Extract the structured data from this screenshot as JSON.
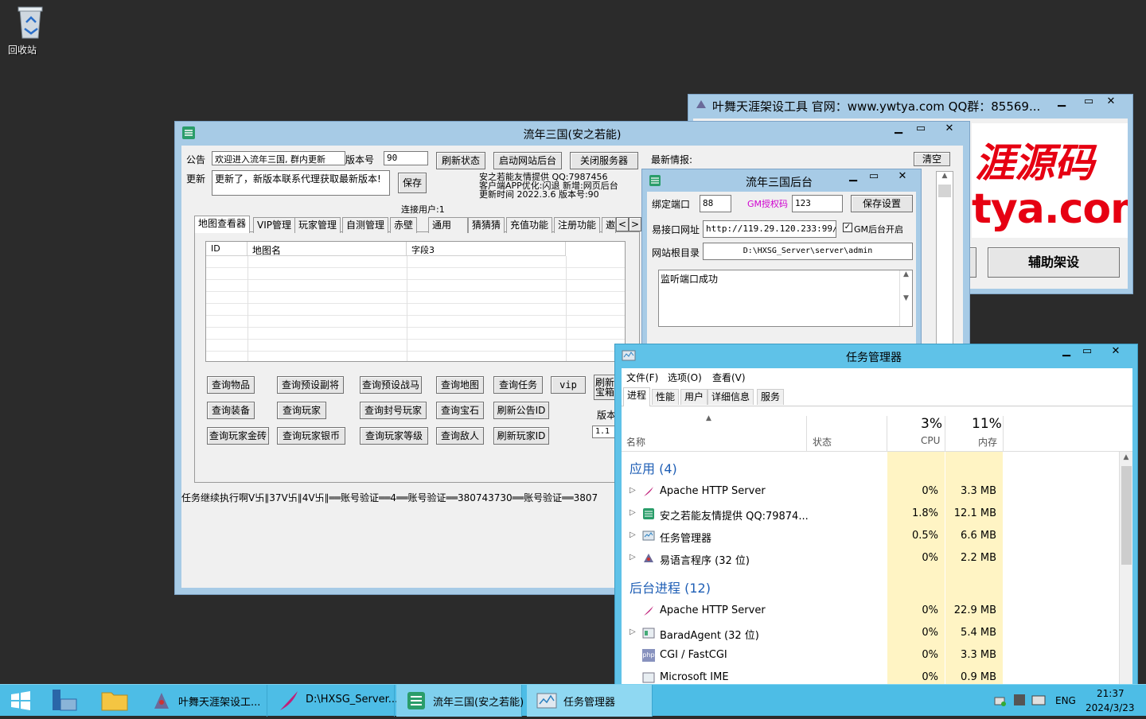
{
  "desktop": {
    "recycle_bin_label": "回收站"
  },
  "main_window": {
    "title": "流年三国(安之若能)",
    "notice_label": "公告",
    "notice_value": "欢迎进入流年三国,  群内更新",
    "version_label": "版本号",
    "version_value": "90",
    "refresh_status": "刷新状态",
    "start_web": "启动网站后台",
    "close_server": "关闭服务器",
    "update_label": "更新",
    "update_value": "更新了，新版本联系代理获取最新版本!",
    "save": "保存",
    "info_lines": [
      "安之若能友情提供  QQ:7987456",
      "客户端APP优化:闪退 新增:网页后台",
      "更新时间 2022.3.6  版本号:90"
    ],
    "connected_users": "连接用户:1",
    "tabs": [
      "地图查看器",
      "VIP管理",
      "玩家管理",
      "自测管理",
      "赤壁",
      "通用",
      "猜猜猜",
      "充值功能",
      "注册功能",
      "邀"
    ],
    "tab_arrows": [
      "<",
      ">"
    ],
    "table_headers": [
      "ID",
      "地图名",
      "字段3"
    ],
    "buttons_row1": [
      "查询物品",
      "查询预设副将",
      "查询预设战马",
      "查询地图",
      "查询任务",
      "vip",
      "刷新宝箱"
    ],
    "buttons_row2": [
      "查询装备",
      "查询玩家",
      "查询封号玩家",
      "查询宝石",
      "刷新公告ID"
    ],
    "buttons_row3": [
      "查询玩家金砖",
      "查询玩家银币",
      "查询玩家等级",
      "查询敌人",
      "刷新玩家ID"
    ],
    "side_version_label": "版本",
    "side_version_value": "1.1",
    "latest_info_label": "最新情报:",
    "clear": "清空",
    "status_line": "任务继续执行啊V卐∥37V卐∥4V卐∥══账号验证══4══账号验证══380743730══账号验证══3807"
  },
  "tool_window": {
    "title": "叶舞天涯架设工具  官网：www.ywtya.com   QQ群：85569...",
    "banner_line1": "涯源码",
    "banner_line2": "tya.com",
    "assist_button": "辅助架设"
  },
  "backend_window": {
    "title": "流年三国后台",
    "bind_port_label": "绑定端口",
    "bind_port_value": "88",
    "gm_code_label": "GM授权码",
    "gm_code_value": "123",
    "save_settings": "保存设置",
    "api_url_label": "易接口网址",
    "api_url_value": "http://119.29.120.233:99/",
    "gm_enable_label": "GM后台开启",
    "web_root_label": "网站根目录",
    "web_root_value": "D:\\HXSG_Server\\server\\admin",
    "log_text": "监听端口成功"
  },
  "task_manager": {
    "title": "任务管理器",
    "menu": [
      "文件(F)",
      "选项(O)",
      "查看(V)"
    ],
    "tabs": [
      "进程",
      "性能",
      "用户",
      "详细信息",
      "服务"
    ],
    "col_name": "名称",
    "col_status": "状态",
    "cpu_percent": "3%",
    "cpu_label": "CPU",
    "mem_percent": "11%",
    "mem_label": "内存",
    "group_apps": "应用 (4)",
    "apps": [
      {
        "name": "Apache HTTP Server",
        "cpu": "0%",
        "mem": "3.3 MB",
        "icon": "feather-icon"
      },
      {
        "name": "安之若能友情提供  QQ:79874...",
        "cpu": "1.8%",
        "mem": "12.1 MB",
        "icon": "app-icon"
      },
      {
        "name": "任务管理器",
        "cpu": "0.5%",
        "mem": "6.6 MB",
        "icon": "taskmgr-icon"
      },
      {
        "name": "易语言程序 (32 位)",
        "cpu": "0%",
        "mem": "2.2 MB",
        "icon": "yiyuyan-icon"
      }
    ],
    "group_bg": "后台进程 (12)",
    "bg": [
      {
        "name": "Apache HTTP Server",
        "cpu": "0%",
        "mem": "22.9 MB",
        "icon": "feather-icon"
      },
      {
        "name": "BaradAgent (32 位)",
        "cpu": "0%",
        "mem": "5.4 MB",
        "icon": "service-icon"
      },
      {
        "name": "CGI / FastCGI",
        "cpu": "0%",
        "mem": "3.3 MB",
        "icon": "php-icon"
      },
      {
        "name": "Microsoft IME",
        "cpu": "0%",
        "mem": "0.9 MB",
        "icon": "ime-icon"
      }
    ]
  },
  "taskbar": {
    "items": [
      "叶舞天涯架设工...",
      "D:\\HXSG_Server...",
      "流年三国(安之若能)",
      "任务管理器"
    ],
    "lang": "ENG",
    "time": "21:37",
    "date": "2024/3/23"
  },
  "colors": {
    "accent": "#a7cbe6",
    "taskbar": "#4dbde6",
    "link_blue": "#1e5eb5",
    "banner_red": "#e60012"
  }
}
